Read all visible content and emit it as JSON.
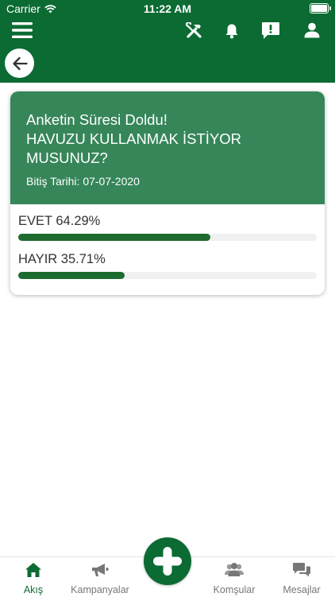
{
  "status_bar": {
    "carrier": "Carrier",
    "time": "11:22 AM"
  },
  "header": {
    "icons": [
      "menu-icon",
      "tools-icon",
      "bell-icon",
      "report-icon",
      "user-icon",
      "back-arrow-icon"
    ]
  },
  "poll": {
    "title": "Anketin Süresi Doldu!",
    "question": "HAVUZU KULLANMAK İSTİYOR MUSUNUZ?",
    "end_date": "Bitiş Tarihi: 07-07-2020",
    "options": [
      {
        "label": "EVET 64.29%",
        "percent": 64.29
      },
      {
        "label": "HAYIR 35.71%",
        "percent": 35.71
      }
    ]
  },
  "tabbar": {
    "items": [
      {
        "label": "Akış",
        "icon": "home-icon",
        "active": true
      },
      {
        "label": "Kampanyalar",
        "icon": "megaphone-icon",
        "active": false
      },
      {
        "label": "Komşular",
        "icon": "people-icon",
        "active": false
      },
      {
        "label": "Mesajlar",
        "icon": "chat-icon",
        "active": false
      }
    ],
    "center_action_icon": "plus-icon"
  },
  "colors": {
    "brand": "#0b6b33",
    "card_header": "#36865a",
    "progress": "#1e6b30"
  }
}
